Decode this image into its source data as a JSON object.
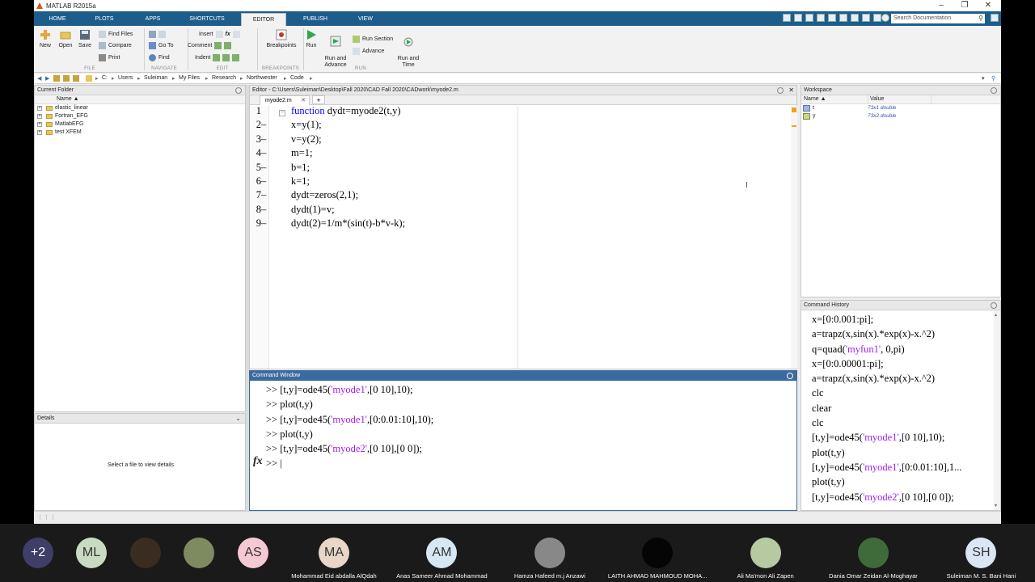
{
  "window": {
    "title": "MATLAB R2015a",
    "controls": [
      "–",
      "❐",
      "✕"
    ]
  },
  "tabs": [
    {
      "label": "HOME"
    },
    {
      "label": "PLOTS"
    },
    {
      "label": "APPS"
    },
    {
      "label": "SHORTCUTS"
    },
    {
      "label": "EDITOR"
    },
    {
      "label": "PUBLISH"
    },
    {
      "label": "VIEW"
    }
  ],
  "search": {
    "placeholder": "Search Documentation"
  },
  "ribbon": {
    "new": "New",
    "open": "Open",
    "save": "Save",
    "find_files": "Find Files",
    "compare": "Compare",
    "print": "Print",
    "go_to": "Go To",
    "find": "Find",
    "insert": "Insert",
    "comment": "Comment",
    "indent": "Indent",
    "fx": "fx",
    "breakpoints": "Breakpoints",
    "run": "Run",
    "run_and_advance": "Run and\nAdvance",
    "run_section": "Run Section",
    "advance": "Advance",
    "run_and_time": "Run and\nTime",
    "groups": {
      "file": "FILE",
      "navigate": "NAVIGATE",
      "edit": "EDIT",
      "breakpoints": "BREAKPOINTS",
      "run": "RUN"
    }
  },
  "address": {
    "drive": "C:",
    "path": [
      "Users",
      "Suleiman",
      "My Files",
      "Research",
      "Northwester",
      "Code"
    ]
  },
  "current_folder": {
    "title": "Current Folder",
    "column": "Name ▲",
    "items": [
      {
        "label": "elastic_linear"
      },
      {
        "label": "Fortran_EFG"
      },
      {
        "label": "MatlabEFG"
      },
      {
        "label": "test XFEM"
      }
    ]
  },
  "details": {
    "title": "Details",
    "empty": "Select a file to view details"
  },
  "editor": {
    "title": "Editor - C:\\Users\\Suleiman\\Desktop\\Fall 2020\\CAD Fall 2020\\CADwork\\myode2.m",
    "file_tab": "myode2.m",
    "lines": [
      {
        "n": "1",
        "dash": "",
        "kw": "function",
        "text": " dydt=myode2(t,y)"
      },
      {
        "n": "2",
        "dash": "–",
        "kw": "",
        "text": "x=y(1);"
      },
      {
        "n": "3",
        "dash": "–",
        "kw": "",
        "text": "v=y(2);"
      },
      {
        "n": "4",
        "dash": "–",
        "kw": "",
        "text": "m=1;"
      },
      {
        "n": "5",
        "dash": "–",
        "kw": "",
        "text": "b=1;"
      },
      {
        "n": "6",
        "dash": "–",
        "kw": "",
        "text": "k=1;"
      },
      {
        "n": "7",
        "dash": "–",
        "kw": "",
        "text": "dydt=zeros(2,1);"
      },
      {
        "n": "8",
        "dash": "–",
        "kw": "",
        "text": "dydt(1)=v;"
      },
      {
        "n": "9",
        "dash": "–",
        "kw": "",
        "text": "dydt(2)=1/m*(sin(t)-b*v-k);"
      }
    ]
  },
  "command_window": {
    "title": "Command Window",
    "lines": [
      {
        "pre": ">> [t,y]=ode45(",
        "str": "'myode1'",
        "post": ",[0 10],10);"
      },
      {
        "pre": ">> plot(t,y)",
        "str": "",
        "post": ""
      },
      {
        "pre": ">> [t,y]=ode45(",
        "str": "'myode1'",
        "post": ",[0:0.01:10],10);"
      },
      {
        "pre": ">> plot(t,y)",
        "str": "",
        "post": ""
      },
      {
        "pre": ">> [t,y]=ode45(",
        "str": "'myode2'",
        "post": ",[0 10],[0 0]);"
      }
    ],
    "prompt": ">> |",
    "fx": "fx"
  },
  "workspace": {
    "title": "Workspace",
    "col_name": "Name ▲",
    "col_value": "Value",
    "vars": [
      {
        "name": "t",
        "value": "73x1 double"
      },
      {
        "name": "y",
        "value": "73x2 double"
      }
    ]
  },
  "history": {
    "title": "Command History",
    "lines": [
      {
        "pre": "x=[0:0.001:pi];",
        "str": "",
        "post": ""
      },
      {
        "pre": "a=trapz(x,sin(x).*exp(x)-x.^2)",
        "str": "",
        "post": ""
      },
      {
        "pre": "q=quad(",
        "str": "'myfun1'",
        "post": ", 0,pi)"
      },
      {
        "pre": "x=[0:0.00001:pi];",
        "str": "",
        "post": ""
      },
      {
        "pre": "a=trapz(x,sin(x).*exp(x)-x.^2)",
        "str": "",
        "post": ""
      },
      {
        "pre": "clc",
        "str": "",
        "post": ""
      },
      {
        "pre": "clear",
        "str": "",
        "post": ""
      },
      {
        "pre": "clc",
        "str": "",
        "post": ""
      },
      {
        "pre": "[t,y]=ode45(",
        "str": "'myode1'",
        "post": ",[0 10],10);"
      },
      {
        "pre": "plot(t,y)",
        "str": "",
        "post": ""
      },
      {
        "pre": "[t,y]=ode45(",
        "str": "'myode1'",
        "post": ",[0:0.01:10],1..."
      },
      {
        "pre": "plot(t,y)",
        "str": "",
        "post": ""
      },
      {
        "pre": "[t,y]=ode45(",
        "str": "'myode2'",
        "post": ",[0 10],[0 0]);"
      }
    ]
  },
  "meeting": {
    "more_count": "+2",
    "participants": [
      {
        "initials": "ML",
        "name": "",
        "bg": "#c8dbc0",
        "fg": "#333333"
      },
      {
        "initials": "",
        "name": "",
        "bg": "#3a2c20",
        "fg": "#ffffff"
      },
      {
        "initials": "",
        "name": "",
        "bg": "#7e8a60",
        "fg": "#ffffff"
      },
      {
        "initials": "AS",
        "name": "",
        "bg": "#f5c9d3",
        "fg": "#333333"
      },
      {
        "initials": "MA",
        "name": "Mohammad Eid abdalla AlQdah",
        "bg": "#e8d6c8",
        "fg": "#333333"
      },
      {
        "initials": "AM",
        "name": "Anas Sameer Ahmad Mohammad",
        "bg": "#d6e8f3",
        "fg": "#333333"
      },
      {
        "initials": "",
        "name": "Hamza Hafeed m.j Anzawi",
        "bg": "#888888",
        "fg": "#ffffff"
      },
      {
        "initials": "",
        "name": "LAITH AHMAD MAHMOUD MOHA...",
        "bg": "#050505",
        "fg": "#ffffff"
      },
      {
        "initials": "",
        "name": "Ali Ma'mon Ali Zapen",
        "bg": "#b6c9a0",
        "fg": "#ffffff"
      },
      {
        "initials": "",
        "name": "Dania Omar Zeidan Al-Moghayar",
        "bg": "#3f6b3a",
        "fg": "#ffffff"
      },
      {
        "initials": "SH",
        "name": "Suleiman M. S. Bani Hani",
        "bg": "#dbe6f4",
        "fg": "#333333"
      }
    ]
  }
}
